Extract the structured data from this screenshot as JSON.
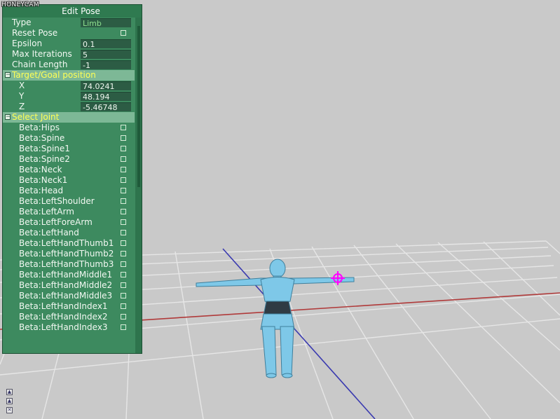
{
  "watermark": "HONEYCAM",
  "panel": {
    "title": "Edit Pose",
    "fields": [
      {
        "label": "Type",
        "value": "Limb"
      },
      {
        "label": "Reset Pose"
      },
      {
        "label": "Epsilon",
        "value": "0.1"
      },
      {
        "label": "Max Iterations",
        "value": "5"
      },
      {
        "label": "Chain Length",
        "value": "-1"
      }
    ],
    "target_section": {
      "label": "Target/Goal position",
      "fields": [
        {
          "label": "X",
          "value": "74.0241"
        },
        {
          "label": "Y",
          "value": "48.194"
        },
        {
          "label": "Z",
          "value": "-5.46748"
        }
      ]
    },
    "joint_section": {
      "label": "Select Joint",
      "joints": [
        "Beta:Hips",
        "Beta:Spine",
        "Beta:Spine1",
        "Beta:Spine2",
        "Beta:Neck",
        "Beta:Neck1",
        "Beta:Head",
        "Beta:LeftShoulder",
        "Beta:LeftArm",
        "Beta:LeftForeArm",
        "Beta:LeftHand",
        "Beta:LeftHandThumb1",
        "Beta:LeftHandThumb2",
        "Beta:LeftHandThumb3",
        "Beta:LeftHandMiddle1",
        "Beta:LeftHandMiddle2",
        "Beta:LeftHandMiddle3",
        "Beta:LeftHandIndex1",
        "Beta:LeftHandIndex2",
        "Beta:LeftHandIndex3"
      ]
    }
  },
  "colors": {
    "panel_bg": "#3d8a5f",
    "section_bg": "#7db896",
    "section_text": "#ffff55",
    "value_bg": "#2c5c44",
    "viewport_bg": "#c9c9c9",
    "grid_line": "#e6e6e6",
    "x_axis": "#b03a3a",
    "z_axis": "#3a3ab0",
    "model": "#7ec8e8",
    "target_marker": "#ff00ff"
  },
  "icons": {
    "section_toggle": "minus-icon",
    "bottom_buttons": [
      "up-arrow-icon",
      "up-arrow-icon",
      "close-icon"
    ]
  }
}
